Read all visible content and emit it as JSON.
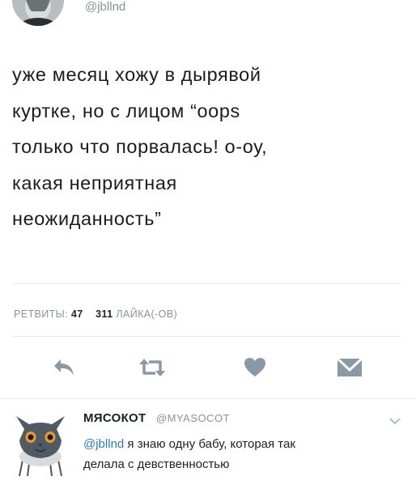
{
  "tweet": {
    "handle": "@jbllnd",
    "text_lines": [
      "уже месяц хожу в дырявой",
      "куртке, но с лицом “oops",
      "только что порвалась! о-оу,",
      "какая неприятная",
      "неожиданность”"
    ],
    "stats": {
      "retweets_label": "РЕТВИТЫ:",
      "retweets_count": "47",
      "likes_count": "311",
      "likes_label": "ЛАЙКА(-ОВ)"
    },
    "actions": [
      {
        "name": "reply",
        "icon": "reply-icon"
      },
      {
        "name": "retweet",
        "icon": "retweet-icon"
      },
      {
        "name": "like",
        "icon": "heart-icon"
      },
      {
        "name": "message",
        "icon": "envelope-icon"
      }
    ]
  },
  "reply": {
    "display_name": "МЯСОКОТ",
    "handle": "@MYASOCOT",
    "mention": "@jbllnd",
    "text_line1_rest": " я знаю одну бабу, которая так",
    "text_line2": "делала с девственностью",
    "avatar_icon": "cat-avatar",
    "menu_icon": "chevron-down-icon"
  },
  "colors": {
    "text": "#1c2022",
    "muted": "#8a9299",
    "icon": "#8b98a5",
    "link": "#2b7bb9",
    "divider": "#e6ecf0"
  }
}
